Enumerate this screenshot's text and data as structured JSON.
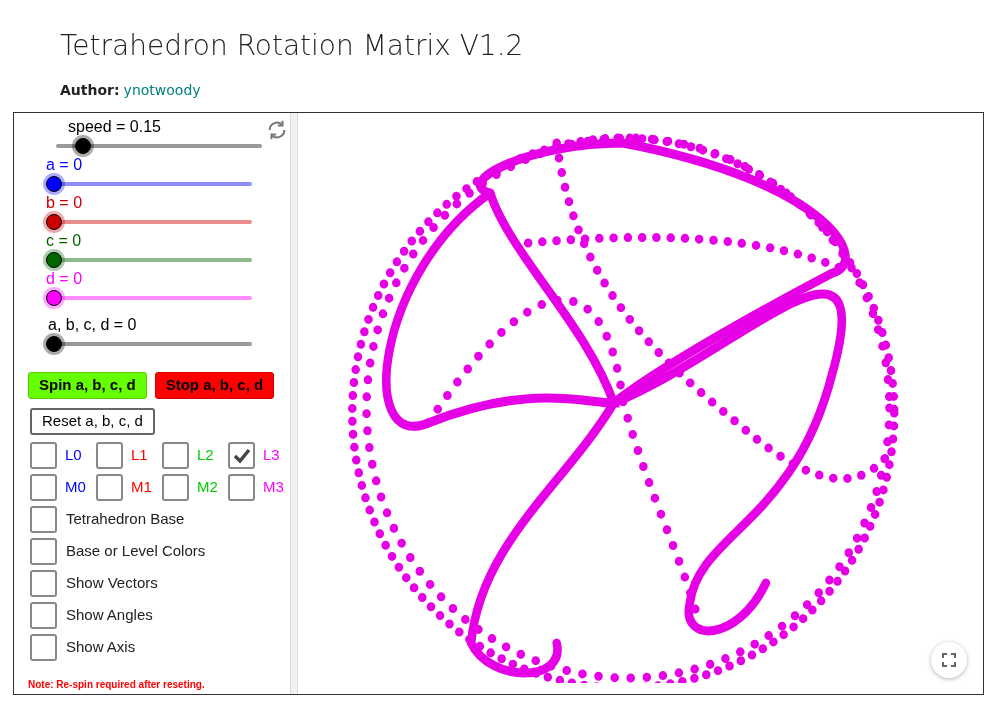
{
  "page": {
    "title": "Tetrahedron Rotation Matrix V1.2",
    "author_label": "Author:",
    "author": "ynotwoody"
  },
  "sliders": [
    {
      "label": "speed = 0.15",
      "color": "#000000",
      "level": 0.1
    },
    {
      "label": "a = 0",
      "color": "#0000ff",
      "level": 0
    },
    {
      "label": "b = 0",
      "color": "#cc0000",
      "level": 0
    },
    {
      "label": "c = 0",
      "color": "#006600",
      "level": 0
    },
    {
      "label": "d = 0",
      "color": "#ff00ff",
      "level": 0
    },
    {
      "label": "a, b, c, d = 0",
      "color": "#000000",
      "level": 0
    }
  ],
  "buttons": [
    {
      "label": "Spin a, b, c, d",
      "kind": "spin"
    },
    {
      "label": "Stop a, b, c, d",
      "kind": "stop"
    },
    {
      "label": "Reset a, b, c, d",
      "kind": "reset"
    }
  ],
  "level_boxes": [
    {
      "label": "L0",
      "color": "#0000ff",
      "checked": false
    },
    {
      "label": "L1",
      "color": "#ff0000",
      "checked": false
    },
    {
      "label": "L2",
      "color": "#00cc00",
      "checked": false
    },
    {
      "label": "L3",
      "color": "#ff00ff",
      "checked": true
    },
    {
      "label": "M0",
      "color": "#0000ff",
      "checked": false
    },
    {
      "label": "M1",
      "color": "#ff0000",
      "checked": false
    },
    {
      "label": "M2",
      "color": "#00cc00",
      "checked": false
    },
    {
      "label": "M3",
      "color": "#ff00ff",
      "checked": false
    }
  ],
  "options": [
    {
      "label": "Tetrahedron Base",
      "checked": false
    },
    {
      "label": "Base or Level Colors",
      "checked": false
    },
    {
      "label": "Show Vectors",
      "checked": false
    },
    {
      "label": "Show Angles",
      "checked": false
    },
    {
      "label": "Show Axis",
      "checked": false
    }
  ],
  "note": "Note: Re-spin required after reseting."
}
